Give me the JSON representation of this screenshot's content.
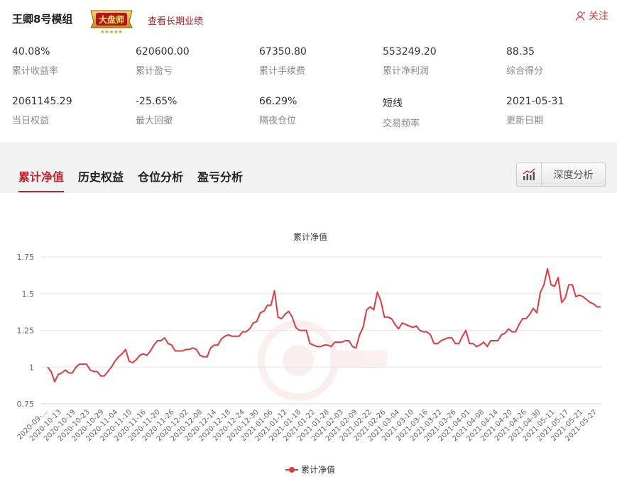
{
  "header": {
    "title": "王卿8号模组",
    "badge_text": "大盘师",
    "badge_stars": "★★★★★",
    "long_term_link": "查看长期业绩",
    "follow_label": "关注"
  },
  "stats": [
    {
      "value": "40.08%",
      "label": "累计收益率"
    },
    {
      "value": "620600.00",
      "label": "累计盈亏"
    },
    {
      "value": "67350.80",
      "label": "累计手续费"
    },
    {
      "value": "553249.20",
      "label": "累计净利润"
    },
    {
      "value": "88.35",
      "label": "综合得分"
    },
    {
      "value": "2061145.29",
      "label": "当日权益"
    },
    {
      "value": "-25.65%",
      "label": "最大回撤"
    },
    {
      "value": "66.29%",
      "label": "隔夜仓位"
    },
    {
      "value": "短线",
      "label": "交易频率"
    },
    {
      "value": "2021-05-31",
      "label": "更新日期"
    }
  ],
  "tabs": [
    {
      "label": "累计净值",
      "active": true
    },
    {
      "label": "历史权益",
      "active": false
    },
    {
      "label": "仓位分析",
      "active": false
    },
    {
      "label": "盈亏分析",
      "active": false
    }
  ],
  "deep_analysis_label": "深度分析",
  "colors": {
    "accent": "#c0242a",
    "line": "#e0393e"
  },
  "chart_data": {
    "type": "line",
    "title": "累计净值",
    "legend": "bottom",
    "grid": true,
    "ylim": [
      0.75,
      1.75
    ],
    "yticks": [
      "0.75",
      "1",
      "1.25",
      "1.5",
      "1.75"
    ],
    "xticks": [
      "2020-09-...",
      "2020-10-13",
      "2020-10-19",
      "2020-10-23",
      "2020-10-29",
      "2020-11-04",
      "2020-11-10",
      "2020-11-16",
      "2020-11-20",
      "2020-11-26",
      "2020-12-02",
      "2020-12-08",
      "2020-12-14",
      "2020-12-18",
      "2020-12-24",
      "2020-12-30",
      "2021-01-06",
      "2021-01-12",
      "2021-01-18",
      "2021-01-22",
      "2021-01-28",
      "2021-02-03",
      "2021-02-09",
      "2021-02-22",
      "2021-02-26",
      "2021-03-04",
      "2021-03-10",
      "2021-03-16",
      "2021-03-22",
      "2021-03-26",
      "2021-04-01",
      "2021-04-08",
      "2021-04-14",
      "2021-04-20",
      "2021-04-26",
      "2021-04-30",
      "2021-05-11",
      "2021-05-17",
      "2021-05-21",
      "2021-05-27"
    ],
    "series": [
      {
        "name": "累计净值",
        "values": [
          1.0,
          0.97,
          0.9,
          0.95,
          0.96,
          0.98,
          0.96,
          0.96,
          1.0,
          1.02,
          1.02,
          1.02,
          0.98,
          0.97,
          0.97,
          0.94,
          0.94,
          0.97,
          1.0,
          1.04,
          1.07,
          1.09,
          1.12,
          1.04,
          1.03,
          1.05,
          1.08,
          1.09,
          1.08,
          1.11,
          1.15,
          1.18,
          1.18,
          1.2,
          1.16,
          1.15,
          1.11,
          1.11,
          1.11,
          1.12,
          1.12,
          1.13,
          1.12,
          1.08,
          1.07,
          1.07,
          1.13,
          1.15,
          1.15,
          1.19,
          1.21,
          1.22,
          1.21,
          1.21,
          1.21,
          1.24,
          1.24,
          1.26,
          1.3,
          1.31,
          1.37,
          1.38,
          1.42,
          1.42,
          1.52,
          1.34,
          1.33,
          1.36,
          1.38,
          1.34,
          1.27,
          1.25,
          1.25,
          1.25,
          1.16,
          1.15,
          1.14,
          1.14,
          1.15,
          1.15,
          1.14,
          1.17,
          1.17,
          1.17,
          1.18,
          1.18,
          1.14,
          1.13,
          1.22,
          1.27,
          1.39,
          1.41,
          1.39,
          1.51,
          1.45,
          1.34,
          1.34,
          1.33,
          1.29,
          1.26,
          1.3,
          1.29,
          1.28,
          1.27,
          1.28,
          1.25,
          1.24,
          1.24,
          1.22,
          1.16,
          1.16,
          1.18,
          1.19,
          1.2,
          1.2,
          1.16,
          1.16,
          1.21,
          1.25,
          1.16,
          1.16,
          1.14,
          1.15,
          1.17,
          1.14,
          1.18,
          1.18,
          1.18,
          1.22,
          1.23,
          1.26,
          1.24,
          1.24,
          1.29,
          1.33,
          1.33,
          1.36,
          1.4,
          1.37,
          1.51,
          1.56,
          1.67,
          1.56,
          1.55,
          1.61,
          1.44,
          1.47,
          1.56,
          1.56,
          1.48,
          1.49,
          1.48,
          1.46,
          1.44,
          1.43,
          1.41,
          1.41
        ]
      }
    ]
  }
}
